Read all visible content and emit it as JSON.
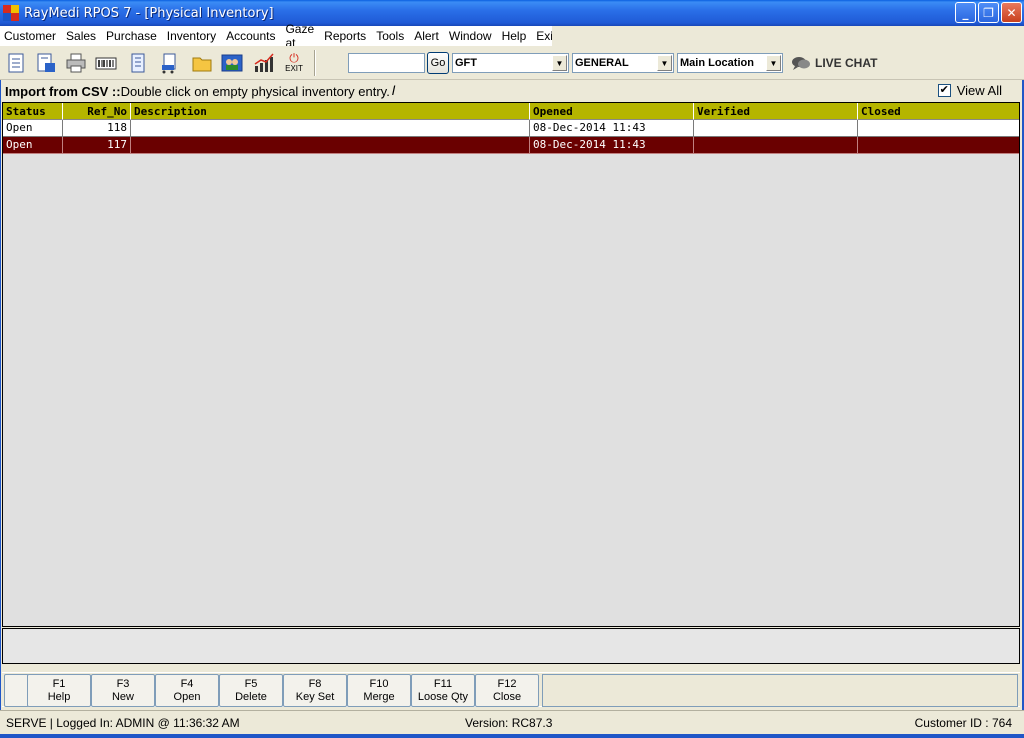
{
  "window": {
    "title": "RayMedi RPOS 7 - [Physical Inventory]",
    "min_label": "_",
    "restore_label": "❐",
    "close_label": "✕"
  },
  "menu": [
    "Customer",
    "Sales",
    "Purchase",
    "Inventory",
    "Accounts",
    "Gaze at",
    "Reports",
    "Tools",
    "Alert",
    "Window",
    "Help",
    "Exit"
  ],
  "toolbar": {
    "exit_label": "EXIT",
    "search_value": "",
    "go_label": "Go",
    "combo1": "GFT",
    "combo2": "GENERAL",
    "combo3": "Main Location",
    "live_chat": "LIVE CHAT"
  },
  "info": {
    "label": "Import from CSV ::",
    "text": " Double click on empty physical inventory entry.",
    "view_all": "View All",
    "view_all_checked": true
  },
  "grid": {
    "columns": [
      "Status",
      "Ref_No",
      "Description",
      "Opened",
      "Verified",
      "Closed"
    ],
    "rows": [
      {
        "status": "Open",
        "ref_no": "118",
        "description": "",
        "opened": "08-Dec-2014 11:43",
        "verified": "",
        "closed": ""
      },
      {
        "status": "Open",
        "ref_no": "117",
        "description": "",
        "opened": "08-Dec-2014 11:43",
        "verified": "",
        "closed": ""
      }
    ]
  },
  "fkeys": [
    {
      "key": "F1",
      "label": "Help"
    },
    {
      "key": "F3",
      "label": "New"
    },
    {
      "key": "F4",
      "label": "Open"
    },
    {
      "key": "F5",
      "label": "Delete"
    },
    {
      "key": "F8",
      "label": "Key Set"
    },
    {
      "key": "F10",
      "label": "Merge"
    },
    {
      "key": "F11",
      "label": "Loose Qty"
    },
    {
      "key": "F12",
      "label": "Close"
    }
  ],
  "status": {
    "left": "SERVE |  Logged In: ADMIN  @ 11:36:32 AM",
    "version": "Version: RC87.3",
    "customer": "Customer ID : 764"
  },
  "colors": {
    "header_bg": "#b5b500",
    "selected_row": "#6a0000",
    "titlebar": "#2a6fe8"
  }
}
